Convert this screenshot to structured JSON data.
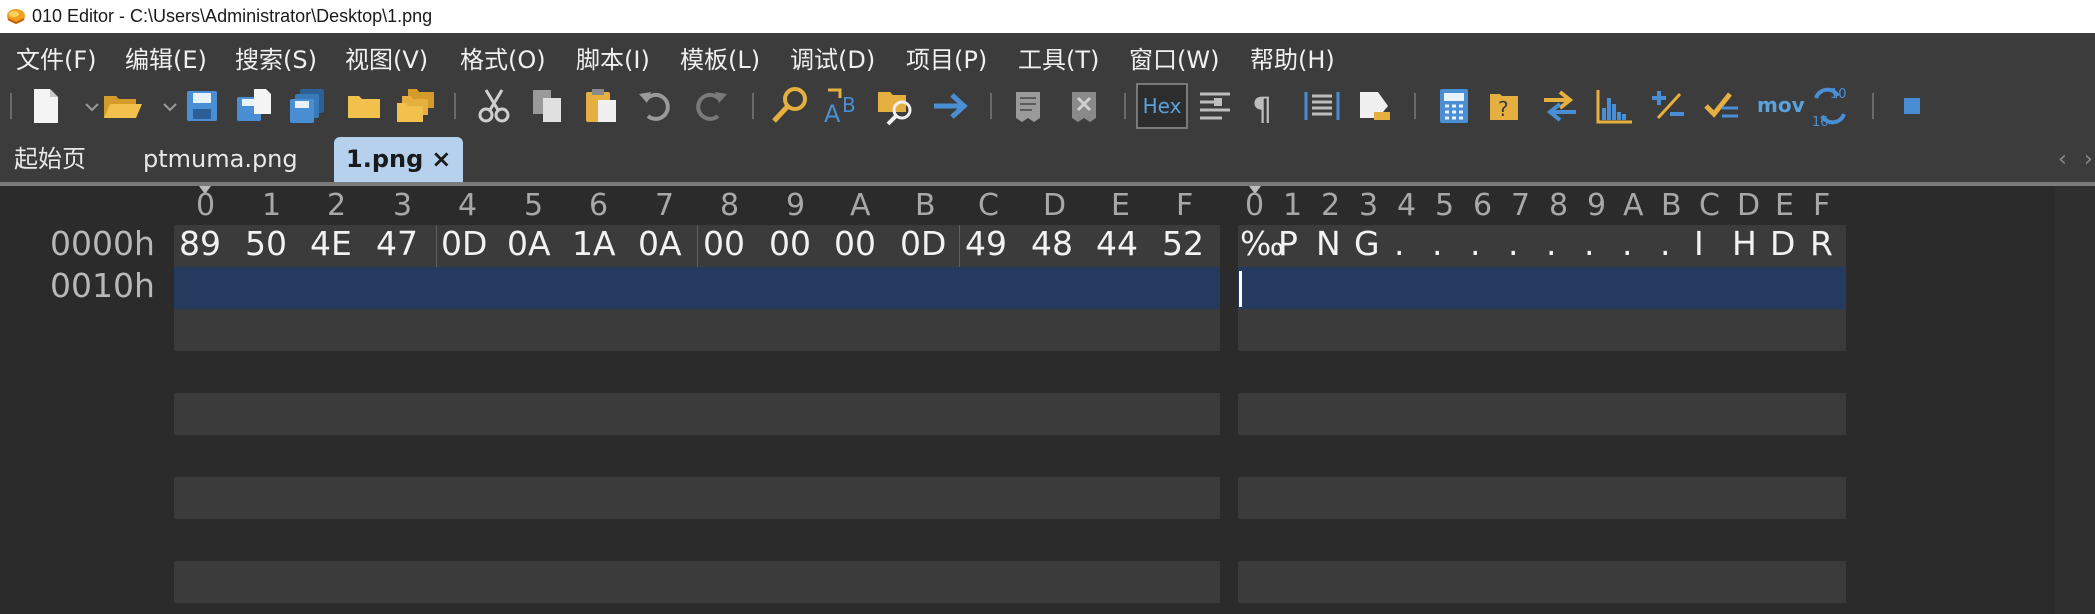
{
  "window": {
    "title": "010 Editor - C:\\Users\\Administrator\\Desktop\\1.png"
  },
  "menu": {
    "items": [
      "文件(F)",
      "编辑(E)",
      "搜索(S)",
      "视图(V)",
      "格式(O)",
      "脚本(I)",
      "模板(L)",
      "调试(D)",
      "项目(P)",
      "工具(T)",
      "窗口(W)",
      "帮助(H)"
    ]
  },
  "toolbar": {
    "hex_label": "Hex",
    "mov_label": "mov",
    "icons": [
      "new-file-icon",
      "open-folder-icon",
      "save-icon",
      "save-as-icon",
      "save-all-icon",
      "open-workspace-icon",
      "open-folders-icon",
      "cut-icon",
      "copy-icon",
      "paste-icon",
      "undo-icon",
      "redo-icon",
      "find-icon",
      "replace-icon",
      "find-in-files-icon",
      "goto-icon",
      "run-script-icon",
      "run-template-icon",
      "hex-mode",
      "columns-icon",
      "pilcrow-icon",
      "text-lines-icon",
      "highlight-icon",
      "calculator-icon",
      "compare-icon",
      "swap-icon",
      "histogram-icon",
      "plus-minus-icon",
      "checksum-icon",
      "mov-icon",
      "base-convert-icon",
      "stop-icon"
    ],
    "colors": {
      "blue": "#5aa2dc",
      "gold": "#e8b54a",
      "gray": "#bdbdbd"
    }
  },
  "tabs": {
    "items": [
      {
        "label": "起始页",
        "active": false
      },
      {
        "label": "ptmuma.png",
        "active": false
      },
      {
        "label": "1.png",
        "active": true
      }
    ],
    "close_glyph": "×",
    "scroll_left": "‹",
    "scroll_right": "›"
  },
  "hex": {
    "column_headers": [
      "0",
      "1",
      "2",
      "3",
      "4",
      "5",
      "6",
      "7",
      "8",
      "9",
      "A",
      "B",
      "C",
      "D",
      "E",
      "F"
    ],
    "char_headers": [
      "0",
      "1",
      "2",
      "3",
      "4",
      "5",
      "6",
      "7",
      "8",
      "9",
      "A",
      "B",
      "C",
      "D",
      "E",
      "F"
    ],
    "rows": [
      {
        "address": "0000h",
        "bytes": [
          "89",
          "50",
          "4E",
          "47",
          "0D",
          "0A",
          "1A",
          "0A",
          "00",
          "00",
          "00",
          "0D",
          "49",
          "48",
          "44",
          "52"
        ],
        "chars": [
          "‰",
          "P",
          "N",
          "G",
          ".",
          ".",
          ".",
          ".",
          ".",
          ".",
          ".",
          ".",
          "I",
          "H",
          "D",
          "R"
        ]
      },
      {
        "address": "0010h",
        "bytes": [],
        "chars": []
      }
    ],
    "colors": {
      "background": "#2b2b2b",
      "stripe": "#3b3b3b",
      "selection": "#243a5e",
      "text": "#f2f2f2"
    }
  }
}
